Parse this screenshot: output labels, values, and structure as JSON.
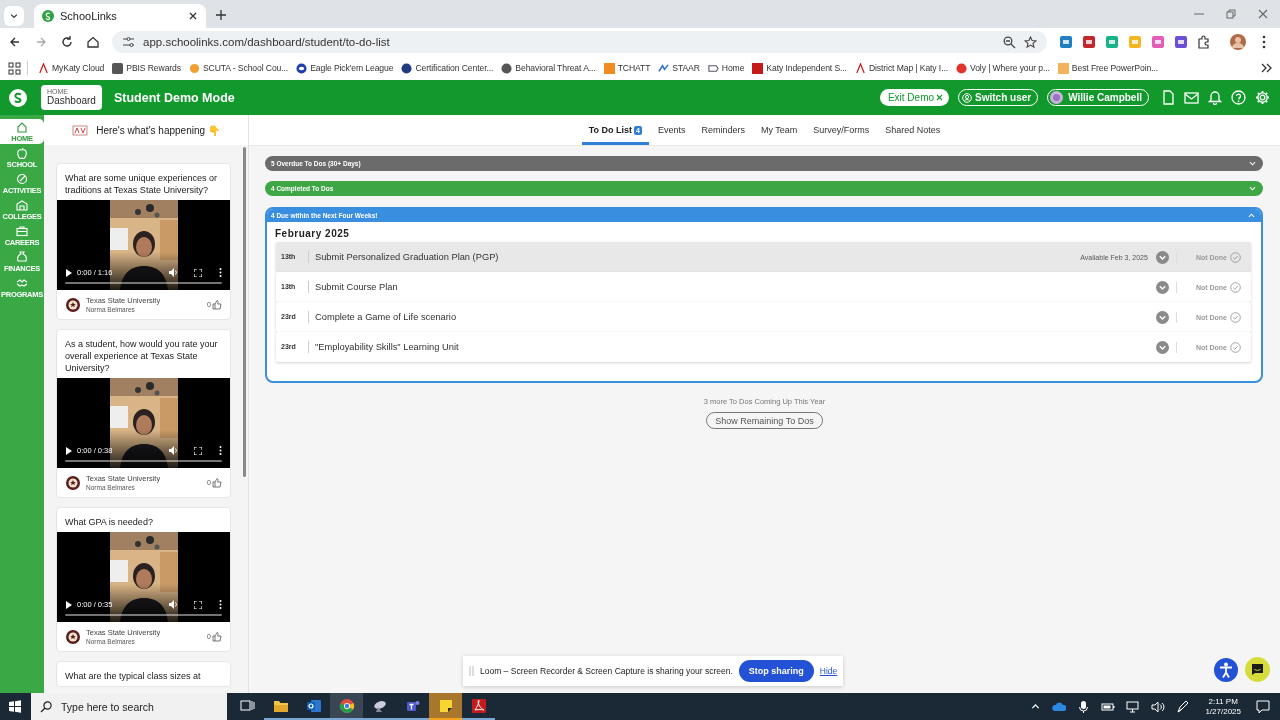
{
  "browser": {
    "tab_title": "SchooLinks",
    "url": "app.schoolinks.com/dashboard/student/to-do-list",
    "bookmarks": [
      "MyKaty Cloud",
      "PBIS Rewards",
      "SCUTA - School Cou...",
      "Eagle Pick'em League",
      "Certification Center...",
      "Behavioral Threat A...",
      "TCHATT",
      "STAAR",
      "Home",
      "Katy Independent S...",
      "District Map | Katy I...",
      "Voly | Where your p...",
      "Best Free PowerPoin..."
    ]
  },
  "header": {
    "crumb_parent": "HOME",
    "crumb": "Dashboard",
    "title": "Student Demo Mode",
    "exit_demo": "Exit Demo",
    "switch_user": "Switch user",
    "user": "Willie Campbell"
  },
  "nav": [
    {
      "label": "HOME",
      "selected": true
    },
    {
      "label": "SCHOOL",
      "selected": false
    },
    {
      "label": "ACTIVITIES",
      "selected": false
    },
    {
      "label": "COLLEGES",
      "selected": false
    },
    {
      "label": "CAREERS",
      "selected": false
    },
    {
      "label": "FINANCES",
      "selected": false
    },
    {
      "label": "PROGRAMS",
      "selected": false
    }
  ],
  "feed": {
    "title": "Here's what's happening 👇",
    "cards": [
      {
        "kind": "video",
        "question": "What are some unique experiences or traditions at Texas State University?",
        "time": "0:00 / 1:16",
        "school": "Texas State University",
        "author": "Norma Belmares",
        "likes": "0"
      },
      {
        "kind": "video",
        "question": "As a student, how would you rate your overall experience at Texas State University?",
        "time": "0:00 / 0:38",
        "school": "Texas State University",
        "author": "Norma Belmares",
        "likes": "0"
      },
      {
        "kind": "video",
        "question": "What GPA is needed?",
        "time": "0:00 / 0:35",
        "school": "Texas State University",
        "author": "Norma Belmares",
        "likes": "0"
      },
      {
        "kind": "text",
        "question": "What are the typical class sizes at"
      }
    ]
  },
  "tabs": [
    {
      "label": "To Do List",
      "badge": "4",
      "selected": true
    },
    {
      "label": "Events",
      "selected": false
    },
    {
      "label": "Reminders",
      "selected": false
    },
    {
      "label": "My Team",
      "selected": false
    },
    {
      "label": "Survey/Forms",
      "selected": false
    },
    {
      "label": "Shared Notes",
      "selected": false
    }
  ],
  "sections": [
    {
      "title": "5 Overdue To Dos (30+ Days)",
      "color": "#6b6b6b",
      "expanded": false
    },
    {
      "title": "4 Completed To Dos",
      "color": "#3fa646",
      "expanded": false
    },
    {
      "title": "4 Due within the Next Four Weeks!",
      "color": "#3a8ee0",
      "expanded": true,
      "month": "February 2025",
      "items": [
        {
          "day": "13th",
          "title": "Submit Personalized Graduation Plan (PGP)",
          "available": "Available Feb 3, 2025",
          "status": "Not Done",
          "selected": true
        },
        {
          "day": "13th",
          "title": "Submit Course Plan",
          "status": "Not Done",
          "selected": false
        },
        {
          "day": "23rd",
          "title": "Complete a Game of Life scenario",
          "status": "Not Done",
          "selected": false
        },
        {
          "day": "23rd",
          "title": "\"Employability Skills\" Learning Unit",
          "status": "Not Done",
          "selected": false
        }
      ]
    }
  ],
  "more": {
    "note": "3 more To Dos Coming Up This Year",
    "button": "Show Remaining To Dos"
  },
  "loom": {
    "message": "Loom – Screen Recorder & Screen Capture is sharing your screen.",
    "stop": "Stop sharing",
    "hide": "Hide"
  },
  "taskbar": {
    "search_placeholder": "Type here to search",
    "time": "2:11 PM",
    "date": "1/27/2025"
  }
}
